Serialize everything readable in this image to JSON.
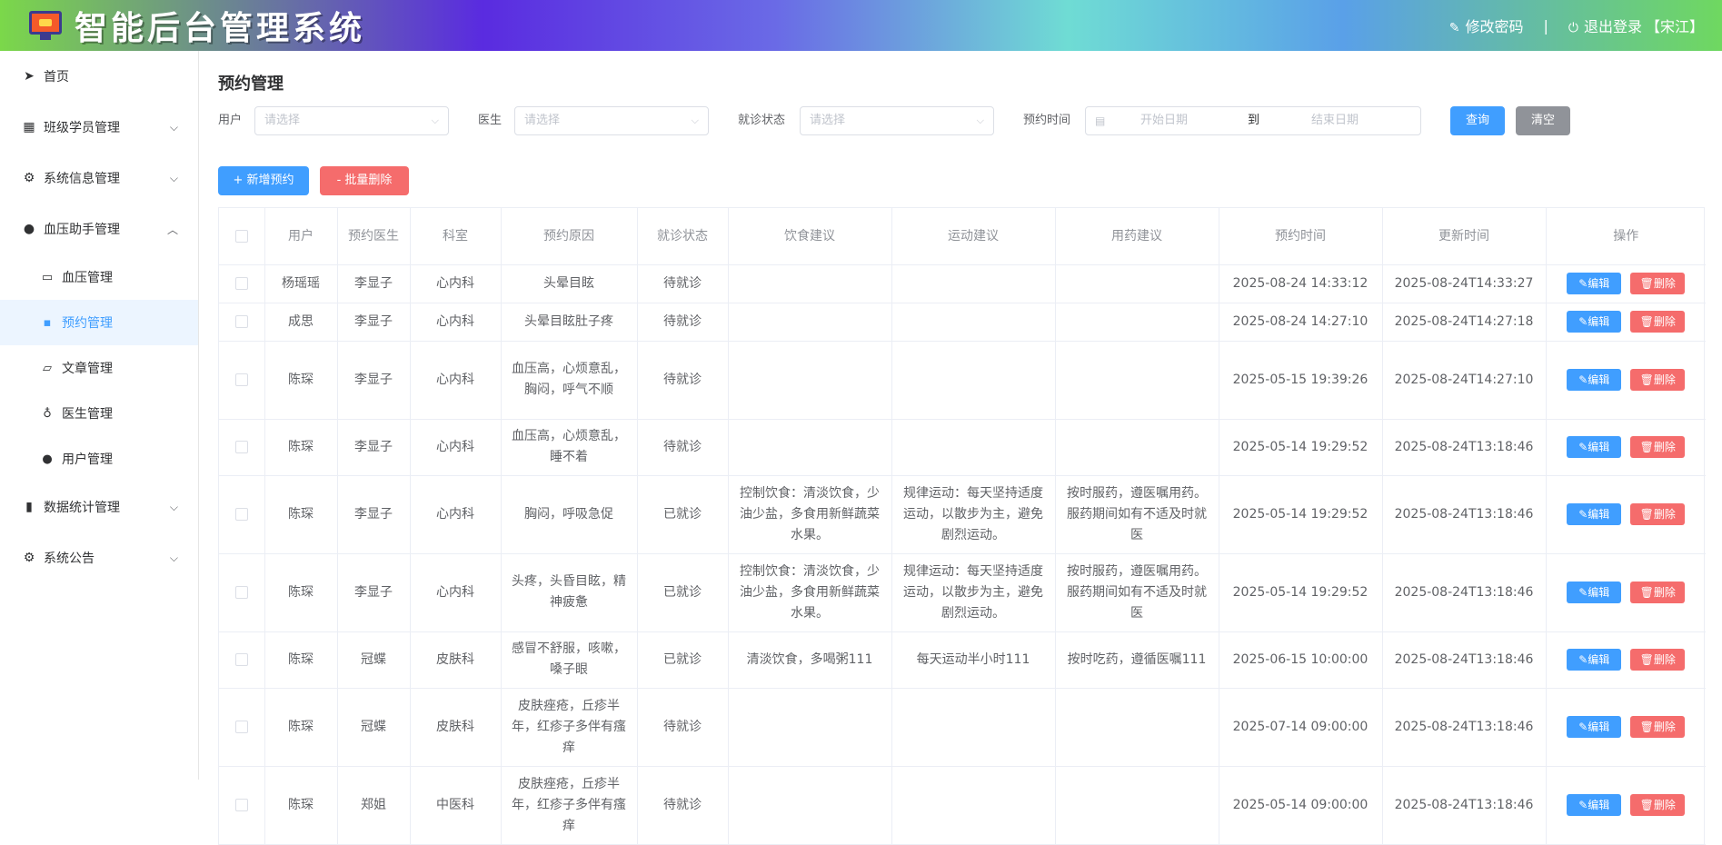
{
  "header": {
    "title": "智能后台管理系统",
    "change_password": "修改密码",
    "separator": "|",
    "logout": "退出登录",
    "username": "【宋江】",
    "colors": {
      "gradient_start": "#7bd84a",
      "gradient_mid": "#5a2be0",
      "gradient_end": "#6fd860"
    }
  },
  "sidebar": {
    "home": "首页",
    "class_members": "班级学员管理",
    "system_info": "系统信息管理",
    "bp_assistant": "血压助手管理",
    "sub": {
      "bp_manage": "血压管理",
      "appointment": "预约管理",
      "article": "文章管理",
      "doctor": "医生管理",
      "user": "用户管理"
    },
    "data_stats": "数据统计管理",
    "announcement": "系统公告",
    "active_color": "#409eff"
  },
  "main": {
    "title": "预约管理",
    "filters": {
      "user_label": "用户",
      "user_placeholder": "请选择",
      "doctor_label": "医生",
      "doctor_placeholder": "请选择",
      "status_label": "就诊状态",
      "status_placeholder": "请选择",
      "time_label": "预约时间",
      "start_placeholder": "开始日期",
      "range_sep": "到",
      "end_placeholder": "结束日期",
      "query_btn": "查询",
      "clear_btn": "清空"
    },
    "actions": {
      "add_btn": "+ 新增预约",
      "batch_delete_btn": "- 批量删除"
    },
    "table": {
      "columns": [
        "用户",
        "预约医生",
        "科室",
        "预约原因",
        "就诊状态",
        "饮食建议",
        "运动建议",
        "用药建议",
        "预约时间",
        "更新时间",
        "操作"
      ],
      "edit_label": "编辑",
      "delete_label": "删除",
      "rows": [
        {
          "user": "杨瑶瑶",
          "doctor": "李显子",
          "dept": "心内科",
          "reason": "头晕目眩",
          "status": "待就诊",
          "diet": "",
          "exercise": "",
          "medication": "",
          "appt_time": "2025-08-24 14:33:12",
          "update_time": "2025-08-24T14:33:27"
        },
        {
          "user": "成思",
          "doctor": "李显子",
          "dept": "心内科",
          "reason": "头晕目眩肚子疼",
          "status": "待就诊",
          "diet": "",
          "exercise": "",
          "medication": "",
          "appt_time": "2025-08-24 14:27:10",
          "update_time": "2025-08-24T14:27:18"
        },
        {
          "user": "陈琛",
          "doctor": "李显子",
          "dept": "心内科",
          "reason": "血压高，心烦意乱，胸闷，呼气不顺",
          "status": "待就诊",
          "diet": "",
          "exercise": "",
          "medication": "",
          "appt_time": "2025-05-15 19:39:26",
          "update_time": "2025-08-24T14:27:10"
        },
        {
          "user": "陈琛",
          "doctor": "李显子",
          "dept": "心内科",
          "reason": "血压高，心烦意乱，睡不着",
          "status": "待就诊",
          "diet": "",
          "exercise": "",
          "medication": "",
          "appt_time": "2025-05-14 19:29:52",
          "update_time": "2025-08-24T13:18:46"
        },
        {
          "user": "陈琛",
          "doctor": "李显子",
          "dept": "心内科",
          "reason": "胸闷，呼吸急促",
          "status": "已就诊",
          "diet": "控制饮食：清淡饮食，少油少盐，多食用新鲜蔬菜水果。",
          "exercise": "规律运动：每天坚持适度运动，以散步为主，避免剧烈运动。",
          "medication": "按时服药，遵医嘱用药。服药期间如有不适及时就医",
          "appt_time": "2025-05-14 19:29:52",
          "update_time": "2025-08-24T13:18:46"
        },
        {
          "user": "陈琛",
          "doctor": "李显子",
          "dept": "心内科",
          "reason": "头疼，头昏目眩，精神疲惫",
          "status": "已就诊",
          "diet": "控制饮食：清淡饮食，少油少盐，多食用新鲜蔬菜水果。",
          "exercise": "规律运动：每天坚持适度运动，以散步为主，避免剧烈运动。",
          "medication": "按时服药，遵医嘱用药。服药期间如有不适及时就医",
          "appt_time": "2025-05-14 19:29:52",
          "update_time": "2025-08-24T13:18:46"
        },
        {
          "user": "陈琛",
          "doctor": "冠蝶",
          "dept": "皮肤科",
          "reason": "感冒不舒服，咳嗽，嗓子眼",
          "status": "已就诊",
          "diet": "清淡饮食，多喝粥111",
          "exercise": "每天运动半小时111",
          "medication": "按时吃药，遵循医嘱111",
          "appt_time": "2025-06-15 10:00:00",
          "update_time": "2025-08-24T13:18:46"
        },
        {
          "user": "陈琛",
          "doctor": "冠蝶",
          "dept": "皮肤科",
          "reason": "皮肤痤疮，丘疹半年，红疹子多伴有瘙痒",
          "status": "待就诊",
          "diet": "",
          "exercise": "",
          "medication": "",
          "appt_time": "2025-07-14 09:00:00",
          "update_time": "2025-08-24T13:18:46"
        },
        {
          "user": "陈琛",
          "doctor": "郑姐",
          "dept": "中医科",
          "reason": "皮肤痤疮，丘疹半年，红疹子多伴有瘙痒",
          "status": "待就诊",
          "diet": "",
          "exercise": "",
          "medication": "",
          "appt_time": "2025-05-14 09:00:00",
          "update_time": "2025-08-24T13:18:46"
        }
      ]
    }
  }
}
